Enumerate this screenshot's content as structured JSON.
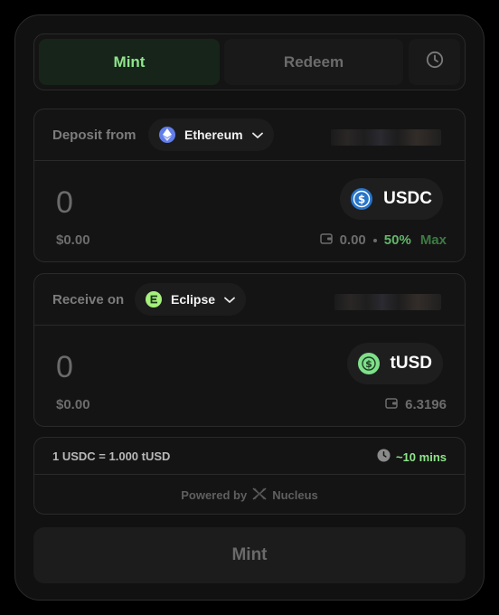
{
  "tabs": {
    "mint": "Mint",
    "redeem": "Redeem"
  },
  "deposit": {
    "label": "Deposit from",
    "chain": "Ethereum",
    "amount": "0",
    "usd": "$0.00",
    "token": "USDC",
    "balance": "0.00",
    "pct": "50%",
    "max": "Max"
  },
  "receive": {
    "label": "Receive on",
    "chain": "Eclipse",
    "amount": "0",
    "usd": "$0.00",
    "token": "tUSD",
    "balance": "6.3196"
  },
  "rate": {
    "text": "1 USDC = 1.000 tUSD",
    "eta": "~10 mins",
    "powered_prefix": "Powered by",
    "powered_brand": "Nucleus"
  },
  "action": {
    "label": "Mint"
  },
  "colors": {
    "accent": "#8ee58a",
    "ethereum": "#627eea",
    "usdc": "#2775ca",
    "eclipse": "#a6f07c"
  },
  "icons": {
    "history": "clock-icon",
    "ethereum": "ethereum-icon",
    "usdc": "usdc-icon",
    "eclipse": "eclipse-icon",
    "tusd": "tusd-icon",
    "wallet": "wallet-icon",
    "nucleus": "nucleus-logo-icon",
    "chevron": "chevron-down-icon"
  }
}
